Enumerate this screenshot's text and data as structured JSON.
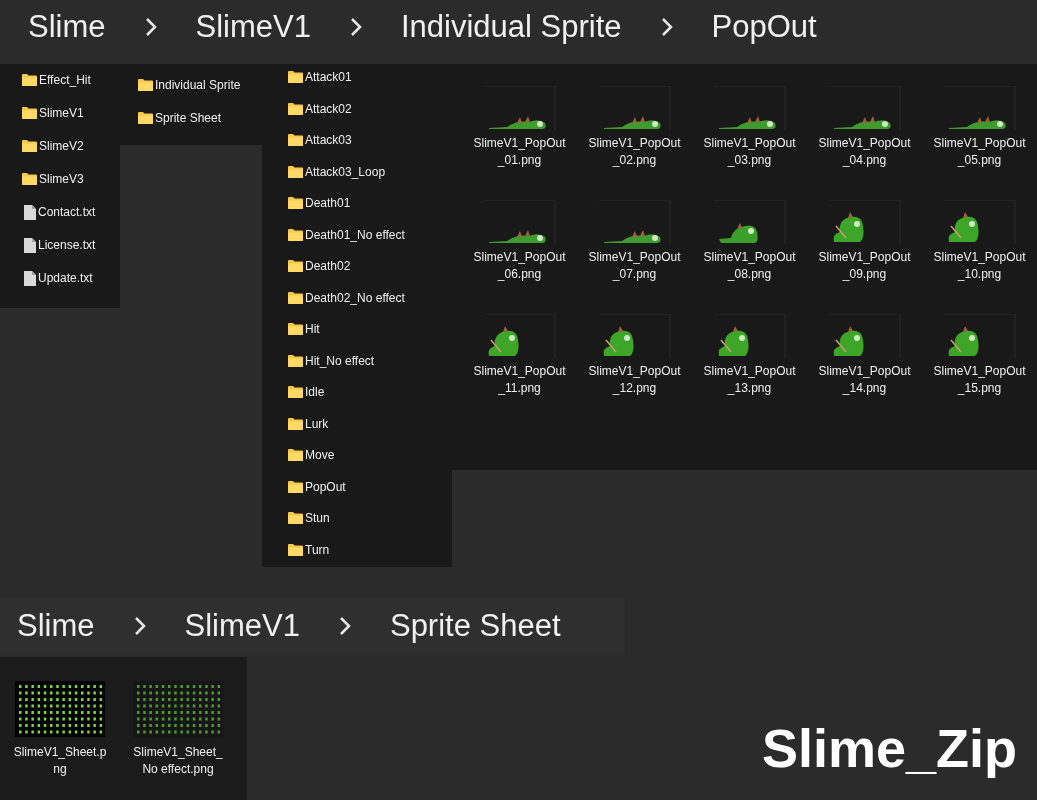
{
  "top_breadcrumb": [
    "Slime",
    "SlimeV1",
    "Individual Sprite",
    "PopOut"
  ],
  "root_folder": [
    {
      "name": "Effect_Hit",
      "kind": "folder"
    },
    {
      "name": "SlimeV1",
      "kind": "folder"
    },
    {
      "name": "SlimeV2",
      "kind": "folder"
    },
    {
      "name": "SlimeV3",
      "kind": "folder"
    },
    {
      "name": "Contact.txt",
      "kind": "file"
    },
    {
      "name": "License.txt",
      "kind": "file"
    },
    {
      "name": "Update.txt",
      "kind": "file"
    }
  ],
  "slimev1_folder": [
    {
      "name": "Individual Sprite",
      "kind": "folder"
    },
    {
      "name": "Sprite Sheet",
      "kind": "folder"
    }
  ],
  "individual_sprite_folder": [
    {
      "name": "Attack01",
      "kind": "folder"
    },
    {
      "name": "Attack02",
      "kind": "folder"
    },
    {
      "name": "Attack03",
      "kind": "folder"
    },
    {
      "name": "Attack03_Loop",
      "kind": "folder"
    },
    {
      "name": "Death01",
      "kind": "folder"
    },
    {
      "name": "Death01_No effect",
      "kind": "folder"
    },
    {
      "name": "Death02",
      "kind": "folder"
    },
    {
      "name": "Death02_No effect",
      "kind": "folder"
    },
    {
      "name": "Hit",
      "kind": "folder"
    },
    {
      "name": "Hit_No effect",
      "kind": "folder"
    },
    {
      "name": "Idle",
      "kind": "folder"
    },
    {
      "name": "Lurk",
      "kind": "folder"
    },
    {
      "name": "Move",
      "kind": "folder"
    },
    {
      "name": "PopOut",
      "kind": "folder"
    },
    {
      "name": "Stun",
      "kind": "folder"
    },
    {
      "name": "Turn",
      "kind": "folder"
    }
  ],
  "popout_files": [
    {
      "line1": "SlimeV1_PopOut",
      "line2": "_01.png",
      "kind": "flat"
    },
    {
      "line1": "SlimeV1_PopOut",
      "line2": "_02.png",
      "kind": "flat"
    },
    {
      "line1": "SlimeV1_PopOut",
      "line2": "_03.png",
      "kind": "flat"
    },
    {
      "line1": "SlimeV1_PopOut",
      "line2": "_04.png",
      "kind": "flat"
    },
    {
      "line1": "SlimeV1_PopOut",
      "line2": "_05.png",
      "kind": "flat"
    },
    {
      "line1": "SlimeV1_PopOut",
      "line2": "_06.png",
      "kind": "flat"
    },
    {
      "line1": "SlimeV1_PopOut",
      "line2": "_07.png",
      "kind": "flat"
    },
    {
      "line1": "SlimeV1_PopOut",
      "line2": "_08.png",
      "kind": "rising"
    },
    {
      "line1": "SlimeV1_PopOut",
      "line2": "_09.png",
      "kind": "upright"
    },
    {
      "line1": "SlimeV1_PopOut",
      "line2": "_10.png",
      "kind": "upright"
    },
    {
      "line1": "SlimeV1_PopOut",
      "line2": "_11.png",
      "kind": "upright"
    },
    {
      "line1": "SlimeV1_PopOut",
      "line2": "_12.png",
      "kind": "upright"
    },
    {
      "line1": "SlimeV1_PopOut",
      "line2": "_13.png",
      "kind": "upright"
    },
    {
      "line1": "SlimeV1_PopOut",
      "line2": "_14.png",
      "kind": "upright"
    },
    {
      "line1": "SlimeV1_PopOut",
      "line2": "_15.png",
      "kind": "upright"
    }
  ],
  "bottom_breadcrumb": [
    "Slime",
    "SlimeV1",
    "Sprite Sheet"
  ],
  "sprite_sheet_files": [
    {
      "line1": "SlimeV1_Sheet.p",
      "line2": "ng",
      "kind": "bright"
    },
    {
      "line1": "SlimeV1_Sheet_",
      "line2": "No effect.png",
      "kind": "dim"
    }
  ],
  "caption": "Slime_Zip"
}
